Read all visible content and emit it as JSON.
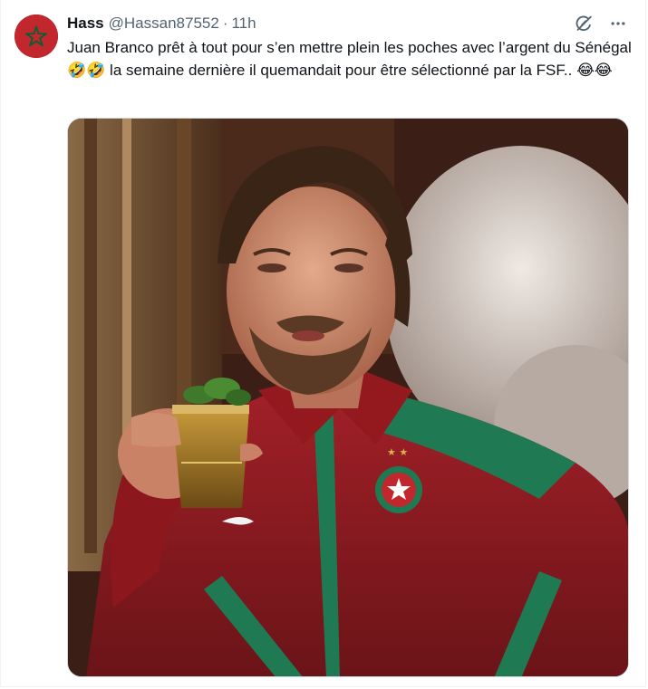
{
  "tweet": {
    "author": {
      "display_name": "Hass",
      "handle": "@Hassan87552",
      "avatar_icon": "morocco-flag-avatar"
    },
    "separator": "·",
    "timestamp": "11h",
    "text": "Juan Branco prêt à tout pour s’en mettre plein les poches avec l’argent du Sénégal 🤣🤣 la semaine dernière il quemandait pour être sélectionné par la FSF.. 😂😂",
    "icons": {
      "grok": "grok-icon",
      "more": "more-icon"
    },
    "media": {
      "type": "photo",
      "subject_icon": "man-in-red-morocco-tracksuit-raising-tea-glass"
    }
  },
  "colors": {
    "text_primary": "#0f1419",
    "text_secondary": "#536471",
    "border": "#cfd9de",
    "morocco_red": "#c1272d",
    "morocco_green": "#006233",
    "jacket_red": "#8b1a1f",
    "jacket_green": "#1f7a53"
  }
}
